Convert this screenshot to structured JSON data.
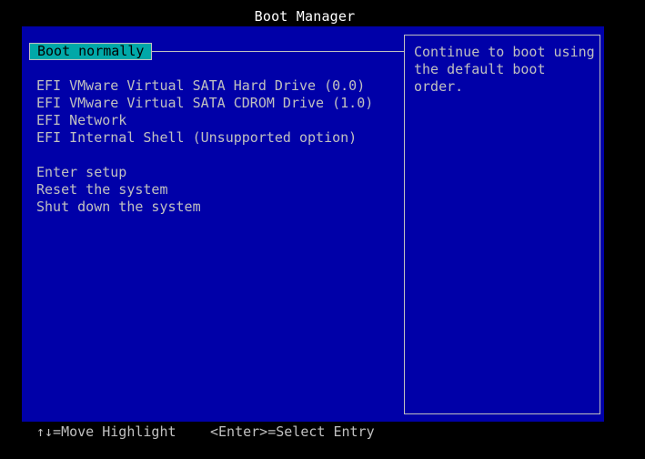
{
  "header": {
    "title": "Boot Manager"
  },
  "menu": {
    "selected": "Boot normally",
    "devices": [
      "EFI VMware Virtual SATA Hard Drive (0.0)",
      "EFI VMware Virtual SATA CDROM Drive (1.0)",
      "EFI Network",
      "EFI Internal Shell (Unsupported option)"
    ],
    "actions": [
      "Enter setup",
      "Reset the system",
      "Shut down the system"
    ]
  },
  "help": {
    "text": "Continue to boot using\nthe default boot order."
  },
  "footer": {
    "move_hint": "↑↓=Move Highlight",
    "select_hint": "<Enter>=Select Entry"
  },
  "colors": {
    "background": "#000000",
    "panel": "#0000a8",
    "highlight": "#00a8a8",
    "text": "#c0c0c0",
    "title": "#ffffff"
  }
}
